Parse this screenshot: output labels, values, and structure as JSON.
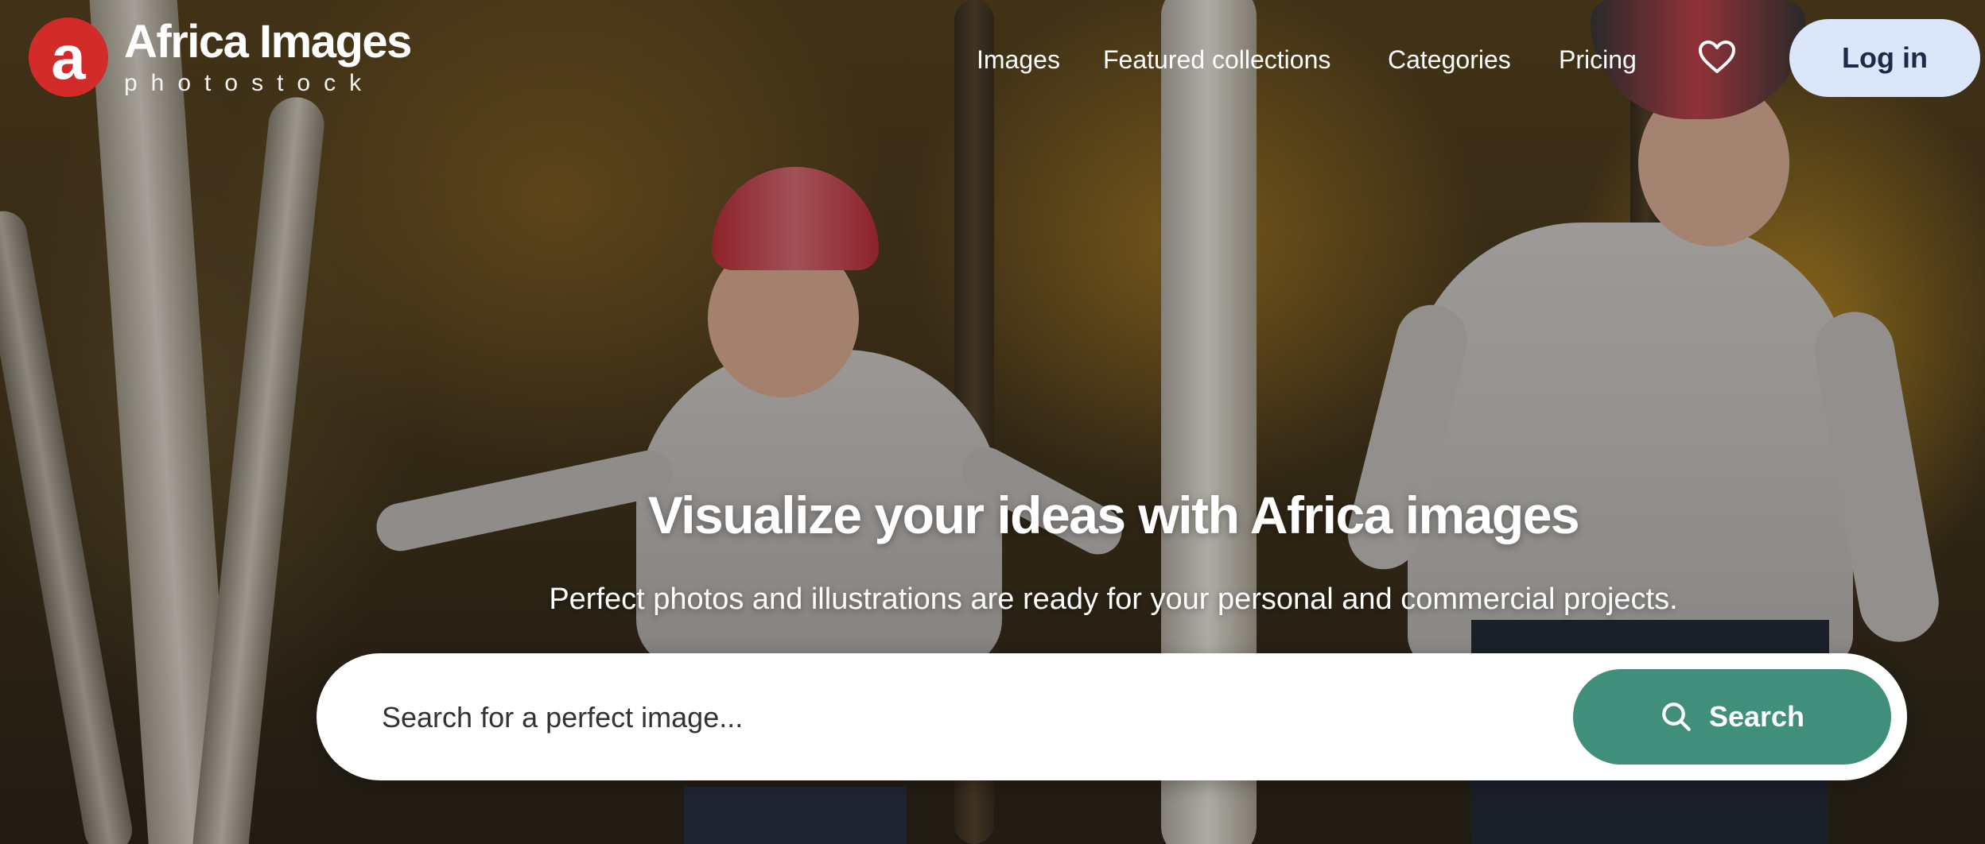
{
  "brand": {
    "logo_letter": "a",
    "name": "Africa Images",
    "tagline": "photostock",
    "color": "#d32a2a"
  },
  "nav": {
    "items": [
      {
        "label": "Images"
      },
      {
        "label": "Featured collections"
      },
      {
        "label": "Categories"
      },
      {
        "label": "Pricing"
      }
    ],
    "favorites_icon": "heart-icon",
    "login_label": "Log in"
  },
  "hero": {
    "title": "Visualize your ideas with Africa images",
    "subtitle": "Perfect photos and illustrations are ready for your personal and commercial projects."
  },
  "search": {
    "placeholder": "Search for a perfect image...",
    "value": "",
    "button_label": "Search",
    "button_icon": "search-icon",
    "button_color": "#3f8f7b"
  }
}
